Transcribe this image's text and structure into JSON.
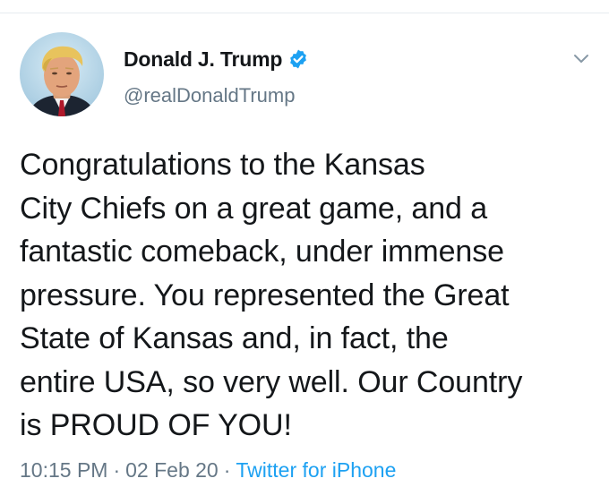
{
  "tweet": {
    "author": {
      "display_name": "Donald J. Trump",
      "handle": "@realDonaldTrump",
      "verified": true
    },
    "text": "Congratulations to the Kansas\nCity Chiefs on a great game, and a\nfantastic comeback, under immense\npressure. You represented the Great\nState of Kansas and, in fact, the\nentire USA, so very well. Our Country\nis PROUD OF YOU!",
    "time": "10:15 PM",
    "date": "02 Feb 20",
    "separator": "·",
    "source": "Twitter for iPhone"
  },
  "colors": {
    "text": "#14171a",
    "secondary": "#657786",
    "accent": "#1da1f2",
    "divider": "#e6ecf0"
  },
  "icons": {
    "verified": "verified-badge-icon",
    "menu": "chevron-down-icon"
  }
}
